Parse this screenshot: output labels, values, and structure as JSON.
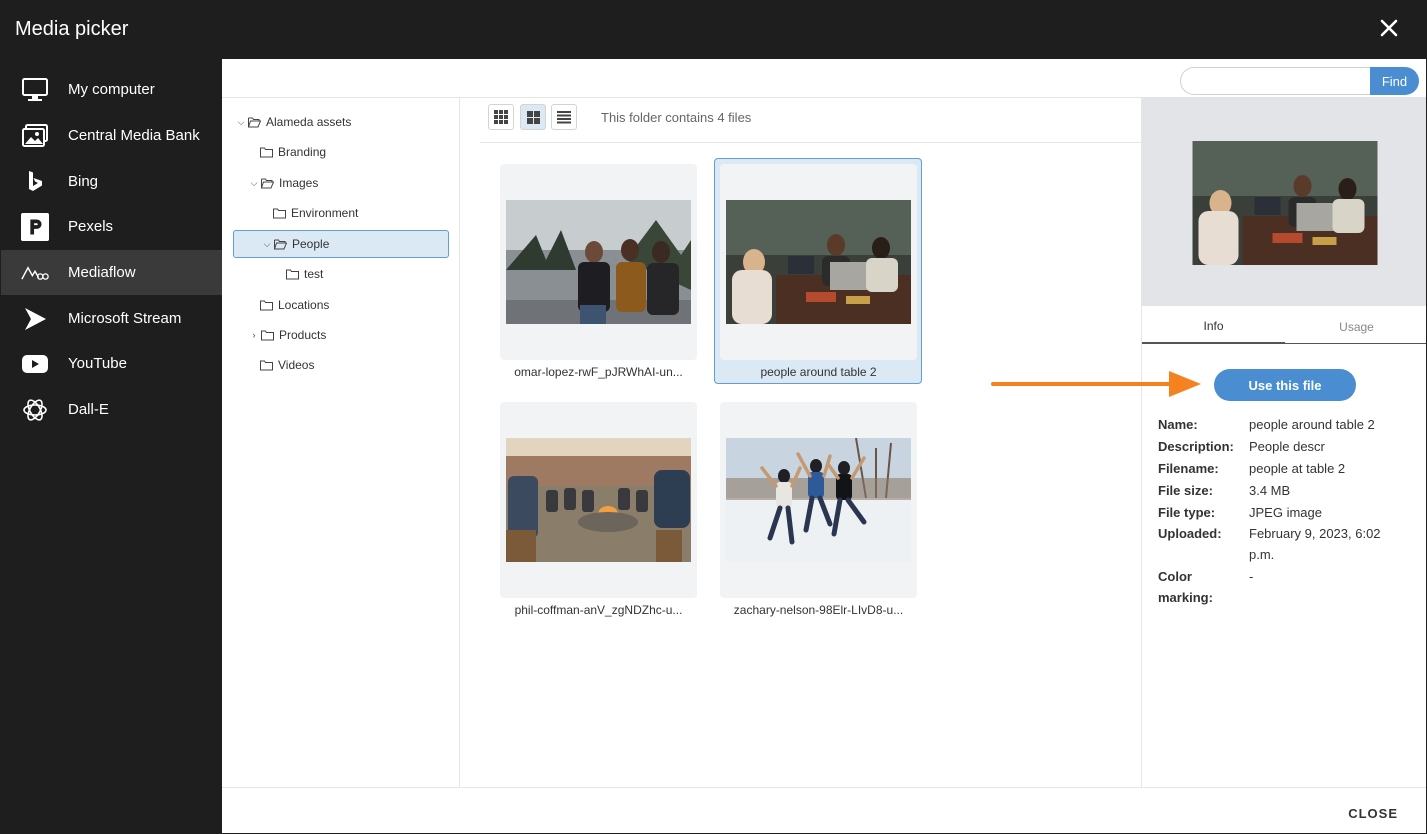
{
  "dialog": {
    "title": "Media picker"
  },
  "sidebar": {
    "items": [
      {
        "label": "My computer",
        "icon": "monitor-icon"
      },
      {
        "label": "Central Media Bank",
        "icon": "images-icon"
      },
      {
        "label": "Bing",
        "icon": "bing-icon"
      },
      {
        "label": "Pexels",
        "icon": "pexels-icon"
      },
      {
        "label": "Mediaflow",
        "icon": "mediaflow-icon",
        "active": true
      },
      {
        "label": "Microsoft Stream",
        "icon": "stream-icon"
      },
      {
        "label": "YouTube",
        "icon": "youtube-icon"
      },
      {
        "label": "Dall-E",
        "icon": "openai-icon"
      }
    ]
  },
  "search": {
    "value": "",
    "placeholder": "",
    "button_label": "Find"
  },
  "tree": {
    "nodes": [
      {
        "label": "Alameda assets",
        "expanded": true
      },
      {
        "label": "Branding"
      },
      {
        "label": "Images",
        "expanded": true
      },
      {
        "label": "Environment"
      },
      {
        "label": "People",
        "expanded": true,
        "selected": true
      },
      {
        "label": "test"
      },
      {
        "label": "Locations"
      },
      {
        "label": "Products",
        "collapsed": true
      },
      {
        "label": "Videos"
      }
    ]
  },
  "toolbar": {
    "folder_info": "This folder contains 4 files",
    "views": [
      "grid-small-icon",
      "grid-large-icon",
      "list-icon"
    ],
    "active_view": "grid-large-icon"
  },
  "files": [
    {
      "name": "omar-lopez-rwF_pJRWhAI-un..."
    },
    {
      "name": "people around table 2",
      "selected": true
    },
    {
      "name": "phil-coffman-anV_zgNDZhc-u..."
    },
    {
      "name": "zachary-nelson-98Elr-LIvD8-u..."
    }
  ],
  "details": {
    "tabs": [
      "Info",
      "Usage"
    ],
    "active_tab": "Info",
    "use_button": "Use this file",
    "fields": [
      {
        "key": "Name:",
        "value": "people around table 2"
      },
      {
        "key": "Description:",
        "value": "People descr"
      },
      {
        "key": "Filename:",
        "value": "people at table 2"
      },
      {
        "key": "File size:",
        "value": "3.4 MB"
      },
      {
        "key": "File type:",
        "value": "JPEG image"
      },
      {
        "key": "Uploaded:",
        "value": "February 9, 2023, 6:02 p.m."
      },
      {
        "key": "Color marking:",
        "value": "-"
      }
    ]
  },
  "footer": {
    "close_label": "CLOSE"
  },
  "colors": {
    "accent": "#4a8ed1",
    "sidebar_bg": "#1e1e1e",
    "annotation_arrow": "#f5821f"
  }
}
